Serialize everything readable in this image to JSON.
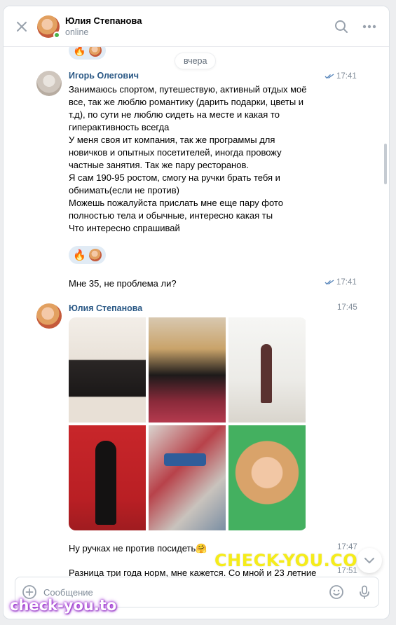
{
  "header": {
    "close_icon": "close-icon",
    "contact_name": "Юлия Степанова",
    "status": "online",
    "search_icon": "search-icon",
    "more_icon": "more-icon"
  },
  "feed": {
    "date_separator": "вчера",
    "messages": [
      {
        "author": "Игорь Олегович",
        "time": "17:41",
        "read": true,
        "text": "Занимаюсь спортом, путешествую, активный отдых моё\nвсе, так же люблю романтику (дарить подарки, цветы и\nт.д), по сути не люблю сидеть на месте и какая то\nгиперактивность всегда\nУ меня своя ит компания, так же программы для\nновичков и опытных посетителей, иногда провожу\nчастные занятия. Так же пару ресторанов.\nЯ сам 190-95 ростом, смогу на ручки брать тебя и\nобнимать(если не против)\nМожешь пожалуйста прислать мне еще пару фото\nполностью тела и обычные, интересно какая ты\nЧто интересно спрашивай",
        "reactions": [
          "🔥",
          "avatar"
        ]
      },
      {
        "author": "",
        "time": "17:41",
        "read": true,
        "text": "Мне 35, не проблема ли?"
      },
      {
        "author": "Юлия Степанова",
        "time": "17:45",
        "photos_count": 6
      },
      {
        "author": "",
        "time": "17:47",
        "text": "Ну ручках не против посидеть🤗"
      },
      {
        "author": "",
        "time": "17:51",
        "text": "Разница три года норм, мне кажется. Со мной и 23 летние"
      }
    ]
  },
  "composer": {
    "placeholder": "Сообщение",
    "attach_icon": "plus-circle-icon",
    "emoji_icon": "smile-icon",
    "mic_icon": "microphone-icon"
  },
  "watermarks": {
    "big": "CHECK-YOU.CO",
    "small": "check-you.to"
  },
  "colors": {
    "accent": "#2a5885",
    "online": "#4bb34b",
    "reaction_bg": "#e1ebf5"
  }
}
